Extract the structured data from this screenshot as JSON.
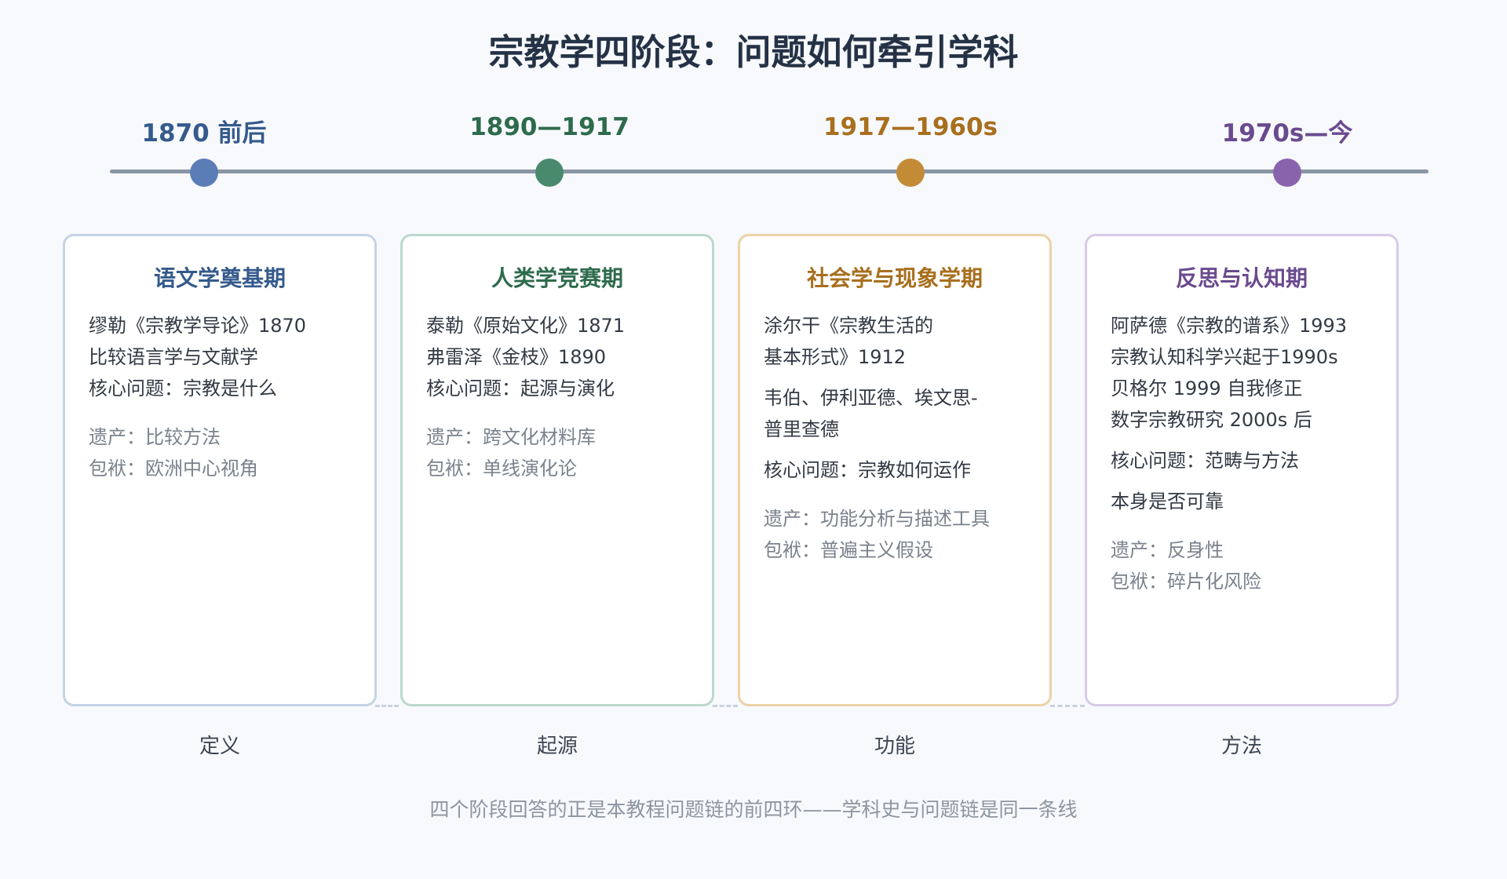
{
  "title": "宗教学四阶段：问题如何牵引学科",
  "stages": [
    {
      "era": "1870 前后",
      "color": "#5b7db7",
      "text_color": "#355a8c",
      "border": "#c5d3e6",
      "name": "语文学奠基期",
      "lines": [
        "缪勒《宗教学导论》1870",
        "比较语言学与文献学",
        "核心问题：宗教是什么"
      ],
      "legacy": "遗产：比较方法",
      "burden": "包袱：欧洲中心视角",
      "theme": "定义"
    },
    {
      "era": "1890—1917",
      "color": "#4a8a6c",
      "text_color": "#2e6b4d",
      "border": "#bcd8cc",
      "name": "人类学竞赛期",
      "lines": [
        "泰勒《原始文化》1871",
        "弗雷泽《金枝》1890",
        "核心问题：起源与演化"
      ],
      "legacy": "遗产：跨文化材料库",
      "burden": "包袱：单线演化论",
      "theme": "起源"
    },
    {
      "era": "1917—1960s",
      "color": "#c48b37",
      "text_color": "#a86f1e",
      "border": "#ecd2a8",
      "name": "社会学与现象学期",
      "lines": [
        "涂尔干《宗教生活的",
        "基本形式》1912",
        "韦伯、伊利亚德、埃文思-",
        "普里查德",
        "核心问题：宗教如何运作"
      ],
      "legacy": "遗产：功能分析与描述工具",
      "burden": "包袱：普遍主义假设",
      "theme": "功能"
    },
    {
      "era": "1970s—今",
      "color": "#8a63ad",
      "text_color": "#6a4a8e",
      "border": "#d7cae9",
      "name": "反思与认知期",
      "lines": [
        "阿萨德《宗教的谱系》1993",
        "宗教认知科学兴起于1990s",
        "贝格尔 1999 自我修正",
        "数字宗教研究 2000s 后",
        "核心问题：范畴与方法",
        "本身是否可靠"
      ],
      "legacy": "遗产：反身性",
      "burden": "包袱：碎片化风险",
      "theme": "方法"
    }
  ],
  "footer": "四个阶段回答的正是本教程问题链的前四环——学科史与问题链是同一条线"
}
